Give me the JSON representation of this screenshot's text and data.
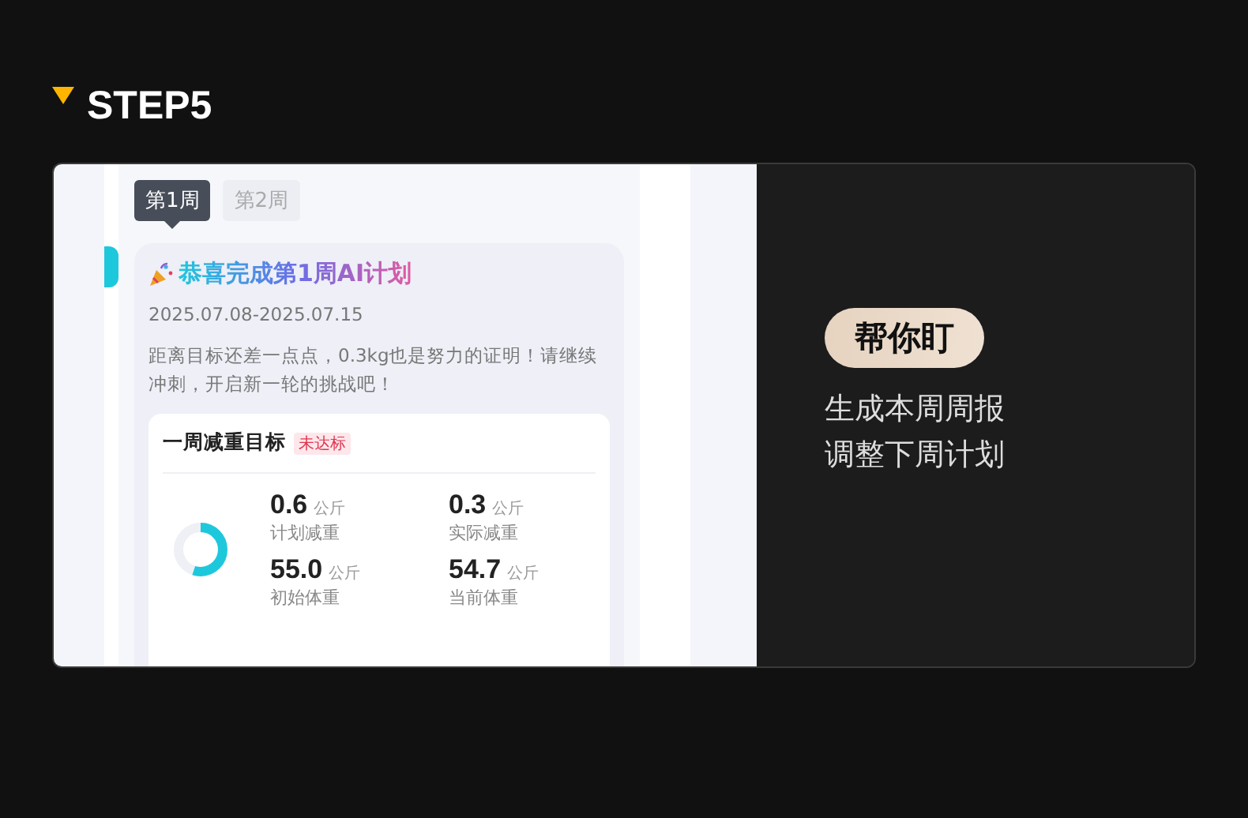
{
  "step": {
    "label": "STEP5"
  },
  "weeks": [
    {
      "label": "第1周",
      "selected": true
    },
    {
      "label": "第2周",
      "selected": false
    }
  ],
  "report": {
    "title": "恭喜完成第1周AI计划",
    "dates": "2025.07.08-2025.07.15",
    "message": "距离目标还差一点点，0.3kg也是努力的证明！请继续冲刺，开启新一轮的挑战吧！"
  },
  "goal": {
    "title": "一周减重目标",
    "status": "未达标",
    "stats": [
      {
        "value": "0.6",
        "unit": "公斤",
        "label": "计划减重"
      },
      {
        "value": "0.3",
        "unit": "公斤",
        "label": "实际减重"
      },
      {
        "value": "55.0",
        "unit": "公斤",
        "label": "初始体重"
      },
      {
        "value": "54.7",
        "unit": "公斤",
        "label": "当前体重"
      }
    ]
  },
  "feature": {
    "badge": "帮你盯",
    "lines": [
      "生成本周周报",
      "调整下周计划"
    ]
  }
}
